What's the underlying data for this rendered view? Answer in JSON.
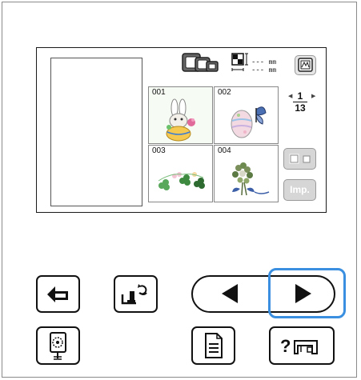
{
  "screen": {
    "dimension_units": [
      "mm",
      "mm"
    ],
    "dimension_values": [
      "---",
      "---"
    ],
    "page": {
      "current": "1",
      "total": "13"
    },
    "imp_label": "Imp."
  },
  "patterns": [
    {
      "number": "001",
      "icon": "bunny-icon"
    },
    {
      "number": "002",
      "icon": "easter-egg-butterfly-icon"
    },
    {
      "number": "003",
      "icon": "shamrock-garland-icon"
    },
    {
      "number": "004",
      "icon": "flower-bouquet-icon"
    }
  ],
  "buttons": {
    "back": "back-arrow-icon",
    "presser_foot_rotate": "presser-foot-rotate-icon",
    "prev": "triangle-left-icon",
    "next": "triangle-right-icon",
    "embroidery": "embroidery-hoop-icon",
    "document": "document-list-icon",
    "help": "help-machine-icon"
  },
  "colors": {
    "highlight": "#3a8fe0"
  }
}
